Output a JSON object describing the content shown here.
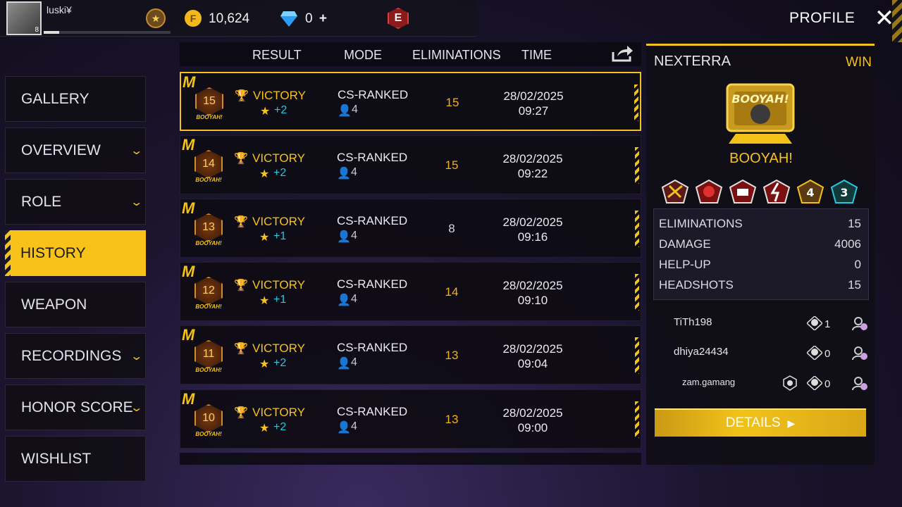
{
  "topbar": {
    "username": "luski¥",
    "level": "8",
    "gold": "10,624",
    "diamonds": "0",
    "diamond_add": "+",
    "rank_letter": "E",
    "title": "PROFILE",
    "close_icon": "close-icon"
  },
  "sidebar": {
    "items": [
      {
        "label": "GALLERY",
        "chevron": false
      },
      {
        "label": "OVERVIEW",
        "chevron": true
      },
      {
        "label": "ROLE",
        "chevron": true
      },
      {
        "label": "HISTORY",
        "chevron": false,
        "active": true
      },
      {
        "label": "WEAPON",
        "chevron": false
      },
      {
        "label": "RECORDINGS",
        "chevron": true
      },
      {
        "label": "HONOR SCORE",
        "chevron": true
      },
      {
        "label": "WISHLIST",
        "chevron": false
      }
    ]
  },
  "table": {
    "headers": {
      "result": "RESULT",
      "mode": "MODE",
      "eliminations": "ELIMINATIONS",
      "time": "TIME"
    },
    "rows": [
      {
        "rank": "15",
        "medal_text": "BOOYAH!",
        "result": "VICTORY",
        "star_gain": "+2",
        "mode": "CS-RANKED",
        "players": "4",
        "eliminations": "15",
        "date": "28/02/2025",
        "time": "09:27"
      },
      {
        "rank": "14",
        "medal_text": "BOOYAH!",
        "result": "VICTORY",
        "star_gain": "+2",
        "mode": "CS-RANKED",
        "players": "4",
        "eliminations": "15",
        "date": "28/02/2025",
        "time": "09:22"
      },
      {
        "rank": "13",
        "medal_text": "BOOYAH!",
        "result": "VICTORY",
        "star_gain": "+1",
        "mode": "CS-RANKED",
        "players": "4",
        "eliminations": "8",
        "date": "28/02/2025",
        "time": "09:16"
      },
      {
        "rank": "12",
        "medal_text": "BOOYAH!",
        "result": "VICTORY",
        "star_gain": "+1",
        "mode": "CS-RANKED",
        "players": "4",
        "eliminations": "14",
        "date": "28/02/2025",
        "time": "09:10"
      },
      {
        "rank": "11",
        "medal_text": "BOOYAH!",
        "result": "VICTORY",
        "star_gain": "+2",
        "mode": "CS-RANKED",
        "players": "4",
        "eliminations": "13",
        "date": "28/02/2025",
        "time": "09:04"
      },
      {
        "rank": "10",
        "medal_text": "BOOYAH!",
        "result": "VICTORY",
        "star_gain": "+2",
        "mode": "CS-RANKED",
        "players": "4",
        "eliminations": "13",
        "date": "28/02/2025",
        "time": "09:00"
      }
    ]
  },
  "detail": {
    "map": "NEXTERRA",
    "outcome": "WIN",
    "booyah_label": "BOOYAH!",
    "booyah_art": "BOOYAH!",
    "award_numbers": [
      "4",
      "3"
    ],
    "stats": [
      {
        "label": "ELIMINATIONS",
        "value": "15"
      },
      {
        "label": "DAMAGE",
        "value": "4006"
      },
      {
        "label": "HELP-UP",
        "value": "0"
      },
      {
        "label": "HEADSHOTS",
        "value": "15"
      }
    ],
    "teammates": [
      {
        "name": "TiTh198",
        "kills": "1"
      },
      {
        "name": "dhiya24434",
        "kills": "0"
      },
      {
        "name": "zam.gamang",
        "kills": "0"
      }
    ],
    "details_button": "DETAILS"
  },
  "colors": {
    "accent": "#f7c21a",
    "cyan": "#27c9e0",
    "panel": "#100e16"
  }
}
